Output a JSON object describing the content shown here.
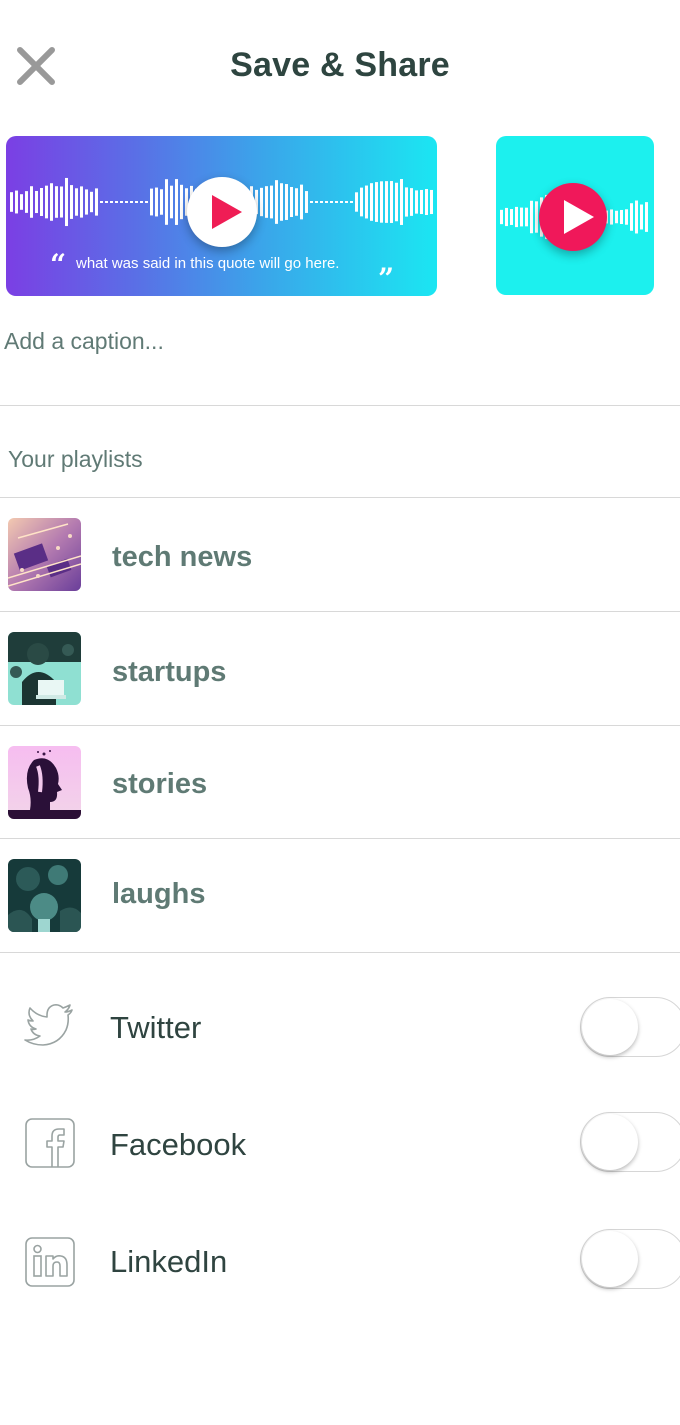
{
  "header": {
    "title": "Save & Share",
    "close_icon": "close-icon"
  },
  "previews": {
    "wide": {
      "quote": "what was said in this quote will go here.",
      "open_quote": "“",
      "close_quote": "”",
      "gradient_colors": [
        "#7b3fe4",
        "#1be6f2"
      ],
      "play_color": "#ef1d55"
    },
    "square": {
      "background": "#1cf0ee",
      "play_color": "#f0185a"
    }
  },
  "caption": {
    "placeholder": "Add a caption..."
  },
  "playlists": {
    "label": "Your playlists",
    "items": [
      {
        "name": "tech news",
        "thumb": "circuit-board-thumbnail"
      },
      {
        "name": "startups",
        "thumb": "laptop-person-thumbnail"
      },
      {
        "name": "stories",
        "thumb": "silhouette-head-thumbnail"
      },
      {
        "name": "laughs",
        "thumb": "comedians-thumbnail"
      }
    ]
  },
  "social": [
    {
      "name": "Twitter",
      "icon": "twitter-icon",
      "enabled": false
    },
    {
      "name": "Facebook",
      "icon": "facebook-icon",
      "enabled": false
    },
    {
      "name": "LinkedIn",
      "icon": "linkedin-icon",
      "enabled": false
    }
  ]
}
